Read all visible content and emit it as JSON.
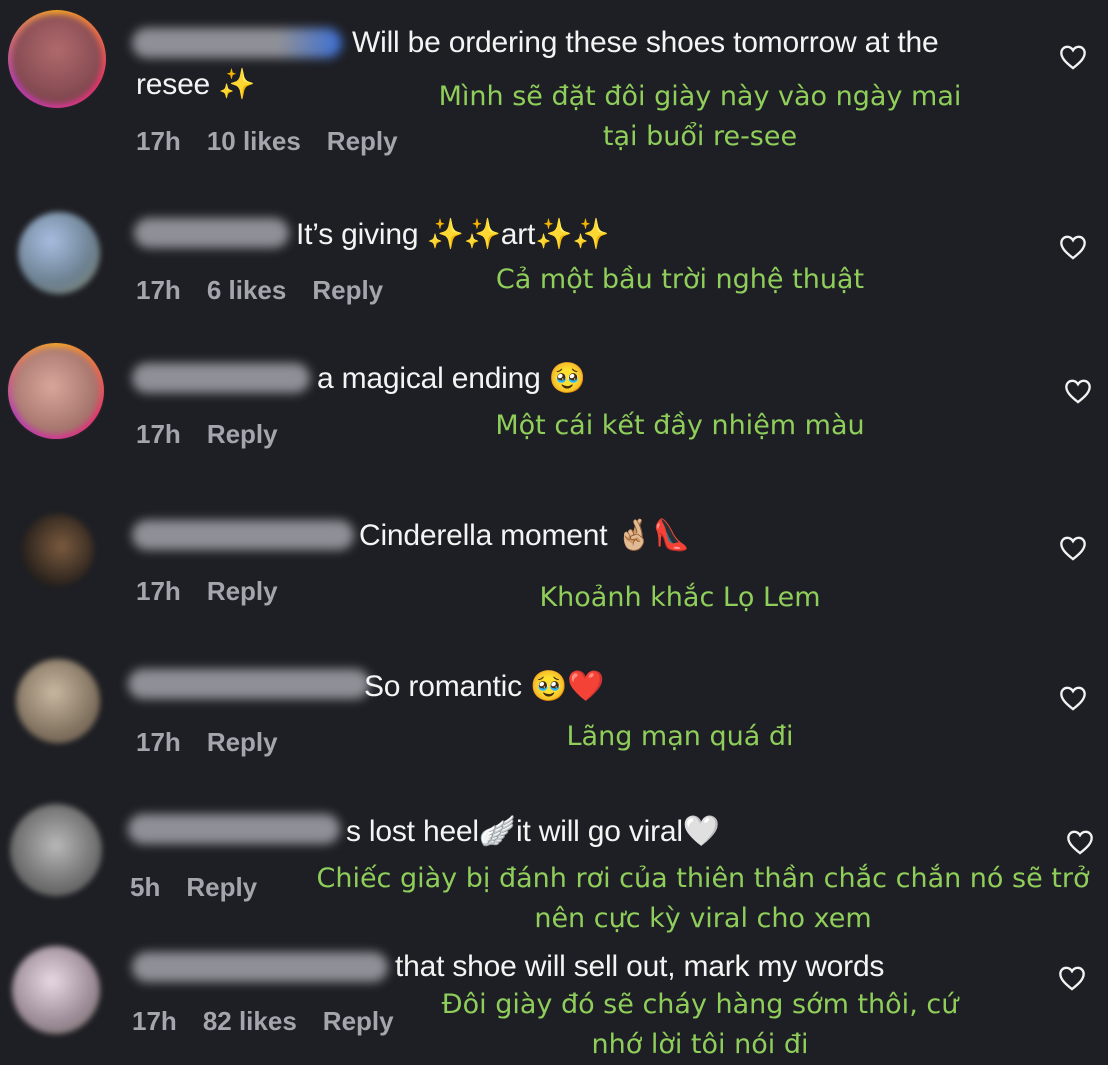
{
  "comments": [
    {
      "text_line1": "Will be ordering these shoes tomorrow at the",
      "text_line2": "resee ✨",
      "time": "17h",
      "likes": "10 likes",
      "reply": "Reply",
      "translation_line1": "Mình sẽ đặt đôi giày này vào ngày mai",
      "translation_line2": "tại buổi re-see"
    },
    {
      "text": "It’s giving ✨✨art✨✨",
      "time": "17h",
      "likes": "6 likes",
      "reply": "Reply",
      "translation": "Cả một bầu trời nghệ thuật"
    },
    {
      "text": "a magical ending 🥹",
      "time": "17h",
      "reply": "Reply",
      "translation": "Một cái kết đầy nhiệm màu"
    },
    {
      "text": "Cinderella moment 🤞🏼👠",
      "time": "17h",
      "reply": "Reply",
      "translation": "Khoảnh khắc Lọ Lem"
    },
    {
      "text": "So romantic 🥹❤️",
      "time": "17h",
      "reply": "Reply",
      "translation": "Lãng mạn quá đi"
    },
    {
      "text": "s lost heel🪽it will go viral🤍",
      "time": "5h",
      "reply": "Reply",
      "translation_line1": "Chiếc giày bị đánh rơi của thiên thần chắc chắn nó sẽ trở",
      "translation_line2": "nên cực kỳ viral cho xem"
    },
    {
      "text": "that shoe will sell out, mark my words",
      "time": "17h",
      "likes": "82 likes",
      "reply": "Reply",
      "translation_line1": "Đôi giày đó sẽ cháy hàng sớm thôi, cứ",
      "translation_line2": "nhớ lời tôi nói đi"
    }
  ],
  "colors": {
    "background": "#1e1f24",
    "comment_text": "#f4f4f4",
    "meta_text": "#a4a6ad",
    "translation_text": "#8fce5a"
  },
  "icons": {
    "like": "heart-outline-icon"
  }
}
